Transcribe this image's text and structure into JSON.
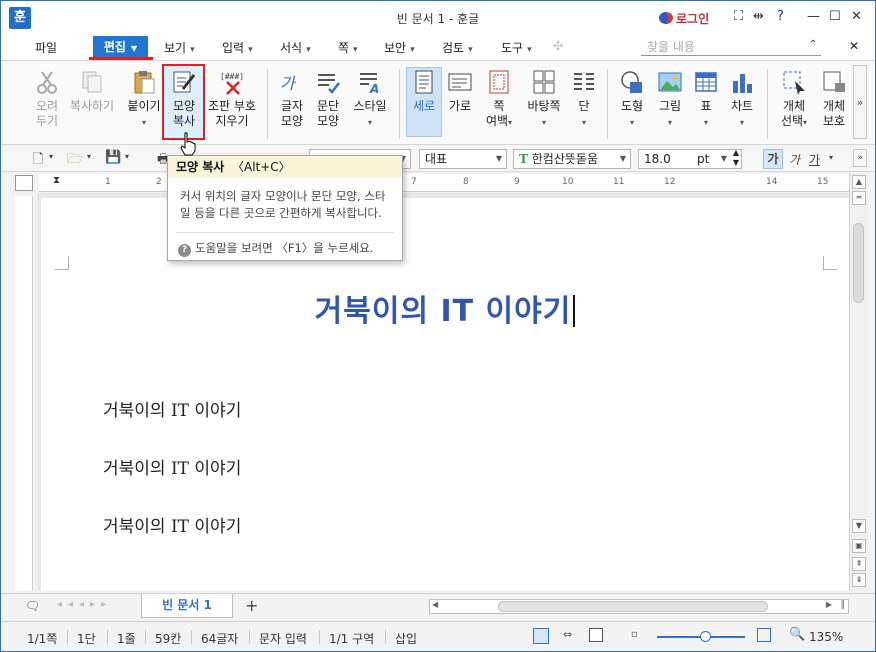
{
  "window": {
    "app_icon": "훈",
    "title": "빈 문서 1 - 훈글",
    "login": "로그인",
    "controls": [
      "⛶",
      "⇹",
      "?",
      "—",
      "☐",
      "✕"
    ]
  },
  "menu": {
    "items": [
      "파일",
      "편집",
      "보기",
      "입력",
      "서식",
      "쪽",
      "보안",
      "검토",
      "도구"
    ],
    "active": "편집",
    "search_placeholder": "찾을 내용",
    "right_controls": [
      "⌃",
      "✕"
    ]
  },
  "ribbon": {
    "buttons": [
      {
        "line1": "오려",
        "line2": "두기",
        "icon": "scissors-icon",
        "disabled": true
      },
      {
        "line1": "복사하기",
        "line2": "",
        "icon": "copy-icon",
        "disabled": true
      },
      {
        "line1": "붙이기",
        "line2": "",
        "icon": "paste-icon",
        "disabled": false
      },
      {
        "line1": "모양",
        "line2": "복사",
        "icon": "format-painter-icon",
        "disabled": false
      },
      {
        "line1": "조판 부호",
        "line2": "지우기",
        "icon": "clear-codes-icon",
        "disabled": false
      },
      {
        "line1": "글자",
        "line2": "모양",
        "icon": "char-shape-icon",
        "disabled": false
      },
      {
        "line1": "문단",
        "line2": "모양",
        "icon": "para-shape-icon",
        "disabled": false
      },
      {
        "line1": "스타일",
        "line2": "",
        "icon": "style-icon",
        "disabled": false
      },
      {
        "line1": "세로",
        "line2": "",
        "icon": "portrait-icon",
        "disabled": false
      },
      {
        "line1": "가로",
        "line2": "",
        "icon": "landscape-icon",
        "disabled": false
      },
      {
        "line1": "쪽",
        "line2": "여백",
        "icon": "margin-icon",
        "disabled": false
      },
      {
        "line1": "바탕쪽",
        "line2": "",
        "icon": "master-page-icon",
        "disabled": false
      },
      {
        "line1": "단",
        "line2": "",
        "icon": "columns-icon",
        "disabled": false
      },
      {
        "line1": "도형",
        "line2": "",
        "icon": "shape-icon",
        "disabled": false
      },
      {
        "line1": "그림",
        "line2": "",
        "icon": "picture-icon",
        "disabled": false
      },
      {
        "line1": "표",
        "line2": "",
        "icon": "table-icon",
        "disabled": false
      },
      {
        "line1": "차트",
        "line2": "",
        "icon": "chart-icon",
        "disabled": false
      },
      {
        "line1": "개체",
        "line2": "선택",
        "icon": "select-object-icon",
        "disabled": false
      },
      {
        "line1": "개체",
        "line2": "보호",
        "icon": "protect-object-icon",
        "disabled": false
      }
    ],
    "more": "»"
  },
  "formatbar": {
    "style": "대표",
    "font": "한컴산뜻돋움",
    "font_badge": "T",
    "size": "18.0",
    "unit": "pt",
    "bold": "가",
    "italic": "가",
    "underline": "가"
  },
  "ruler": {
    "numbers": [
      "1",
      "2",
      "7",
      "8",
      "9",
      "10",
      "11",
      "12",
      "14",
      "15"
    ]
  },
  "document": {
    "title": "거북이의 IT 이야기",
    "lines": [
      "거북이의 IT 이야기",
      "거북이의 IT 이야기",
      "거북이의 IT 이야기"
    ]
  },
  "tabs": {
    "active_tab": "빈 문서 1",
    "add": "+"
  },
  "status": {
    "items": [
      "1/1쪽",
      "1단",
      "1줄",
      "59칸",
      "64글자",
      "문자 입력",
      "1/1 구역",
      "삽입"
    ],
    "zoom": "135%"
  },
  "tooltip": {
    "title": "모양 복사",
    "shortcut": "〈Alt+C〉",
    "body": "커서 위치의 글자 모양이나 문단 모양, 스타일 등을 다른 곳으로 간편하게 복사합니다.",
    "help": "도움말을 보려면 〈F1〉을 누르세요."
  },
  "colors": {
    "accent": "#1e77d2",
    "highlight": "#e21e1e",
    "title_text": "#2f56b5"
  }
}
